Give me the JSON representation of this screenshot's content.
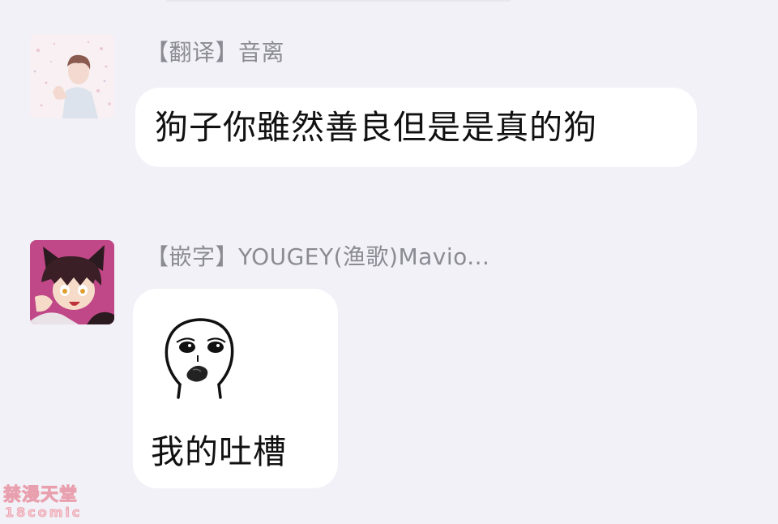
{
  "messages": [
    {
      "avatar": "illustrated-boy-avatar",
      "sender": "【翻译】音离",
      "text": "狗子你雖然善良但是是真的狗"
    },
    {
      "avatar": "anime-catboy-avatar",
      "sender": "【嵌字】YOUGEY(渔歌)Mavio...",
      "sticker": "staring-face-sticker",
      "text": "我的吐槽"
    }
  ],
  "watermark": {
    "line1": "禁漫天堂",
    "line2": "18comic"
  },
  "colors": {
    "background": "#f2f1f7",
    "bubble": "#ffffff",
    "sender_name": "#8b8b93",
    "message_text": "#111111"
  }
}
